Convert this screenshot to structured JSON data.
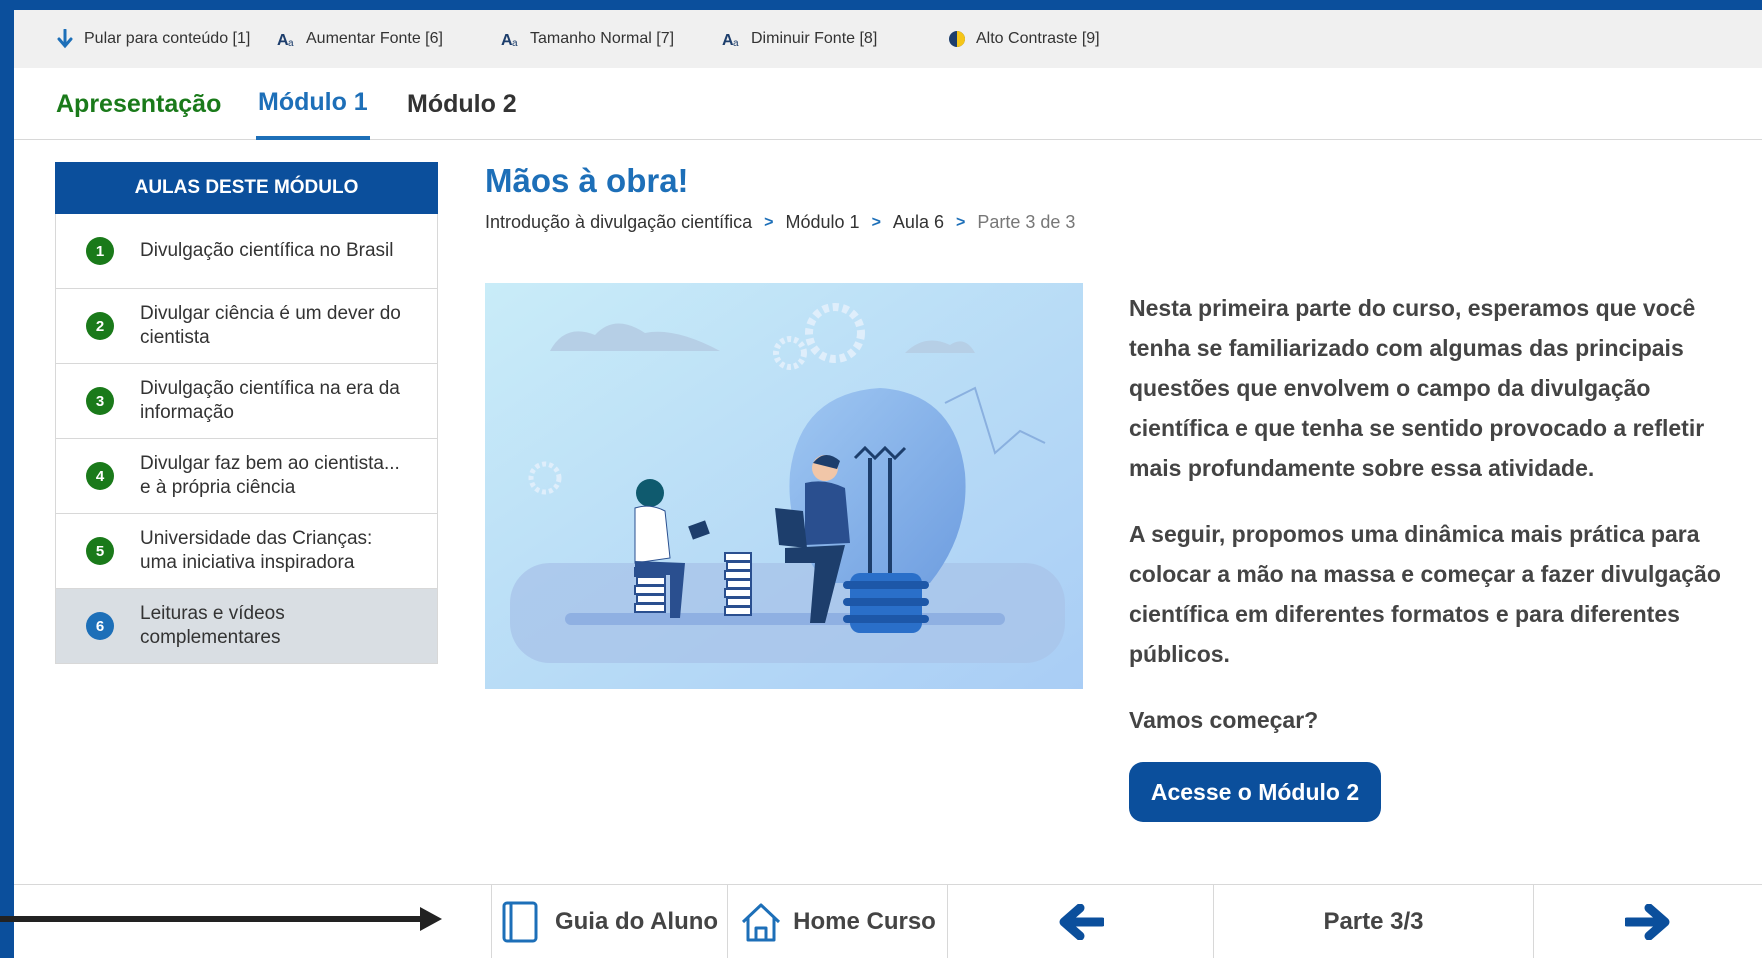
{
  "accessibility_bar": {
    "items": [
      {
        "label": "Pular para conteúdo [1]",
        "icon": "arrow-down-icon"
      },
      {
        "label": "Aumentar Fonte [6]",
        "icon": "font-increase-icon"
      },
      {
        "label": "Tamanho Normal [7]",
        "icon": "font-normal-icon"
      },
      {
        "label": "Diminuir Fonte [8]",
        "icon": "font-decrease-icon"
      },
      {
        "label": "Alto Contraste [9]",
        "icon": "contrast-icon"
      }
    ]
  },
  "tabs": [
    {
      "label": "Apresentação"
    },
    {
      "label": "Módulo 1",
      "active": true
    },
    {
      "label": "Módulo 2"
    }
  ],
  "sidebar": {
    "title": "AULAS DESTE MÓDULO",
    "lessons": [
      {
        "number": "1",
        "label": "Divulgação científica no Brasil"
      },
      {
        "number": "2",
        "label": "Divulgar ciência é um dever do cientista"
      },
      {
        "number": "3",
        "label": "Divulgação científica na era da informação"
      },
      {
        "number": "4",
        "label": "Divulgar faz bem ao cientista... e à própria ciência"
      },
      {
        "number": "5",
        "label": "Universidade das Crianças: uma iniciativa inspiradora"
      },
      {
        "number": "6",
        "label": "Leituras e vídeos complementares",
        "active": true
      }
    ]
  },
  "main": {
    "title": "Mãos à obra!",
    "breadcrumb": [
      "Introdução à divulgação científica",
      "Módulo 1",
      "Aula 6",
      "Parte 3 de 3"
    ],
    "paragraphs": [
      "Nesta primeira parte do curso, esperamos que você tenha se familiarizado com algumas das principais questões que envolvem o campo da divulgação científica e que tenha se sentido provocado a refletir mais profundamente sobre essa atividade.",
      "A seguir, propomos uma dinâmica mais prática para colocar a mão na massa e começar a fazer divulgação científica em diferentes formatos e para diferentes públicos.",
      "Vamos começar?"
    ],
    "cta_label": "Acesse o Módulo 2"
  },
  "footer": {
    "guide_label": "Guia do Aluno",
    "home_label": "Home Curso",
    "page_label": "Parte 3/3"
  },
  "colors": {
    "primary": "#0b4f9c",
    "accent_blue": "#1d6fb8",
    "green": "#1a7a1a"
  }
}
